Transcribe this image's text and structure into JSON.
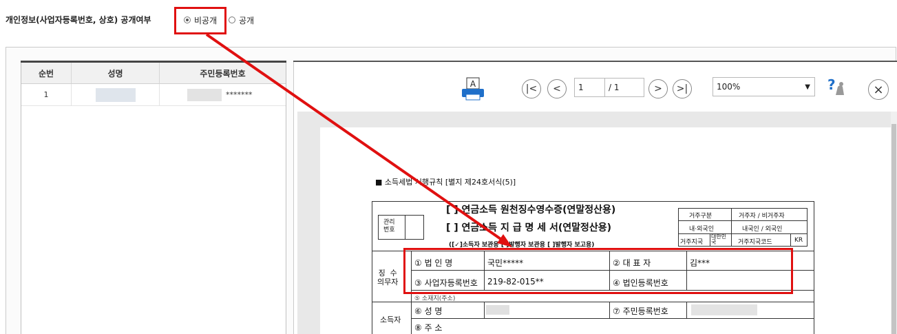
{
  "privacy": {
    "label": "개인정보(사업자등록번호, 상호) 공개여부",
    "options": [
      {
        "label": "비공개",
        "selected": true
      },
      {
        "label": "공개",
        "selected": false
      }
    ]
  },
  "grid": {
    "columns": [
      "순번",
      "성명",
      "주민등록번호"
    ],
    "rows": [
      {
        "no": "1",
        "name": "",
        "rrn": "*******"
      }
    ]
  },
  "viewer": {
    "print_icon": "printer-icon",
    "page_current": "1",
    "page_total": "/ 1",
    "zoom": "100%",
    "nav_first": "|<",
    "nav_prev": "<",
    "nav_next": ">",
    "nav_last": ">|",
    "close": "×",
    "help_icon": "help-icon"
  },
  "document": {
    "rule_header": "■ 소득세법 시행규칙 [별지 제24호서식(5)]",
    "title1": "[   ] 연금소득 원천징수영수증(연말정산용)",
    "title2": "[   ] 연금소득 지 급 명 세 서(연말정산용)",
    "manage_no": "관리\n번호",
    "copy_line": "([✓]소득자 보관용  [   ]발행자 보관용  [   ]발행자 보고용)",
    "residence": {
      "r1_label": "거주구분",
      "r1_value": "거주자 / 비거주자",
      "r2_label": "내·외국인",
      "r2_value": "내국인 / 외국인",
      "r3_label": "거주지국",
      "r3_label2": "대한민국",
      "r3_code_label": "거주지국코드",
      "r3_code": "KR"
    },
    "withholder_label": "징  수\n의무자",
    "f1_label": "① 법   인   명",
    "f1_value": "국민*****",
    "f2_label": "② 대   표   자",
    "f2_value": "김***",
    "f3_label": "③ 사업자등록번호",
    "f3_value": "219-82-015**",
    "f4_label": "④ 법인등록번호",
    "f4_value": "",
    "f5_label": "⑤ 소재지(주소)",
    "earner_label": "소득자",
    "f6_label": "⑥ 성         명",
    "f7_label": "⑦ 주민등록번호",
    "f8_label": "⑧ 주         소"
  },
  "colors": {
    "highlight": "#e01010"
  }
}
